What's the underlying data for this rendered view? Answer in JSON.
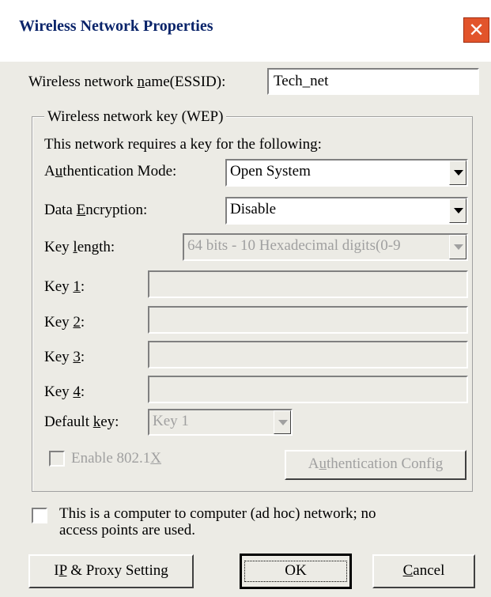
{
  "window": {
    "title": "Wireless Network Properties",
    "close_symbol": "✕"
  },
  "ssid": {
    "label_pre": "Wireless network ",
    "label_u": "n",
    "label_post": "ame(ESSID):",
    "value": "Tech_net"
  },
  "wep_group": {
    "legend": "Wireless network key (WEP)",
    "requires_text": "This network requires a key for the following:",
    "auth_mode": {
      "label_pre": "A",
      "label_u": "u",
      "label_post": "thentication Mode:",
      "value": "Open System"
    },
    "encryption": {
      "label_pre": "Data ",
      "label_u": "E",
      "label_post": "ncryption:",
      "value": "Disable"
    },
    "key_length": {
      "label_pre": "Key ",
      "label_u": "l",
      "label_post": "ength:",
      "value": "64 bits - 10 Hexadecimal digits(0-9"
    },
    "keys": [
      {
        "label_pre": "Key ",
        "label_u": "1",
        "label_post": ":"
      },
      {
        "label_pre": "Key ",
        "label_u": "2",
        "label_post": ":"
      },
      {
        "label_pre": "Key ",
        "label_u": "3",
        "label_post": ":"
      },
      {
        "label_pre": "Key ",
        "label_u": "4",
        "label_post": ":"
      }
    ],
    "default_key": {
      "label_pre": "Default ",
      "label_u": "k",
      "label_post": "ey:",
      "value": "Key 1"
    },
    "enable_8021x": {
      "label_pre": "Enable 802.1",
      "label_u": "X",
      "label_post": ""
    },
    "auth_config": {
      "label_pre": "A",
      "label_u": "u",
      "label_post": "thentication Config"
    }
  },
  "adhoc": {
    "line1": "This is a computer to computer (ad hoc) network; no",
    "line2": "access points are used."
  },
  "buttons": {
    "ip_proxy": {
      "label_pre": "I",
      "label_u": "P",
      "label_post": " & Proxy Setting"
    },
    "ok": {
      "label": "OK"
    },
    "cancel": {
      "label_pre": "",
      "label_u": "C",
      "label_post": "ancel"
    }
  }
}
